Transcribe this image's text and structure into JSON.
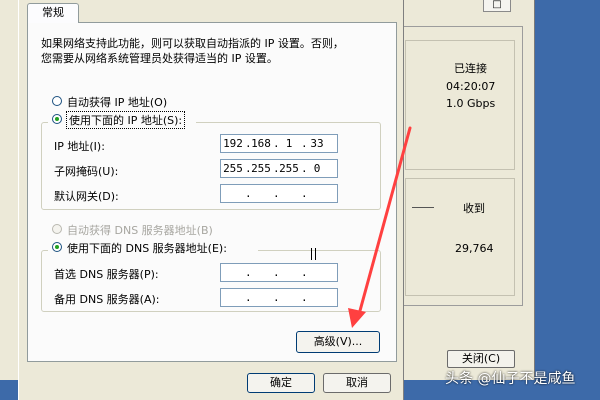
{
  "background_window": {
    "title_button": "□",
    "status": "已连接",
    "duration": "04:20:07",
    "speed": "1.0 Gbps",
    "received_label": "收到",
    "received_bytes": "29,764",
    "close_button": "关闭(C)"
  },
  "dialog": {
    "tab": "常规",
    "description_line1": "如果网络支持此功能，则可以获取自动指派的 IP 设置。否则，",
    "description_line2": "您需要从网络系统管理员处获得适当的 IP 设置。",
    "auto_ip_label": "自动获得 IP 地址(O)",
    "manual_ip_label": "使用下面的 IP 地址(S):",
    "ip_address_label": "IP 地址(I):",
    "subnet_label": "子网掩码(U):",
    "gateway_label": "默认网关(D):",
    "ip_address": [
      "192",
      "168",
      "1",
      "33"
    ],
    "subnet_mask": [
      "255",
      "255",
      "255",
      "0"
    ],
    "gateway": [
      "",
      "",
      "",
      ""
    ],
    "auto_dns_label": "自动获得 DNS 服务器地址(B)",
    "manual_dns_label": "使用下面的 DNS 服务器地址(E):",
    "preferred_dns_label": "首选 DNS 服务器(P):",
    "alternate_dns_label": "备用 DNS 服务器(A):",
    "preferred_dns": [
      "",
      "",
      "",
      ""
    ],
    "alternate_dns": [
      "",
      "",
      "",
      ""
    ],
    "advanced_button": "高级(V)...",
    "ok_button": "确定",
    "cancel_button": "取消"
  },
  "watermark": "头条 @仙子不是咸鱼",
  "colors": {
    "desktop": "#3d6aa9",
    "window_face": "#ece9d8",
    "arrow": "#ff4040",
    "radio_dot": "#21a121"
  }
}
